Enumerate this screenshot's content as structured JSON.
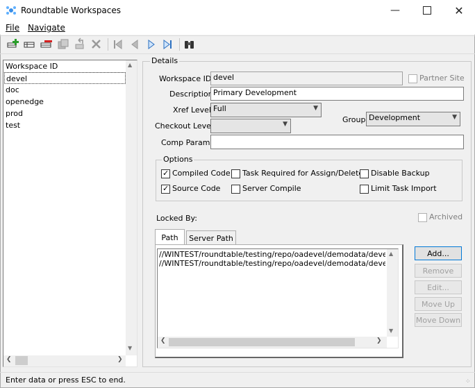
{
  "window": {
    "title": "Roundtable Workspaces"
  },
  "menu": {
    "file": "File",
    "navigate": "Navigate"
  },
  "toolbar": {
    "icons": [
      "add-workspace-icon",
      "edit-workspace-icon",
      "delete-workspace-icon",
      "copy-icon",
      "undo-icon",
      "cancel-icon",
      "first-icon",
      "previous-icon",
      "next-icon",
      "last-icon",
      "find-icon"
    ]
  },
  "list": {
    "header": "Workspace ID",
    "items": [
      "devel",
      "doc",
      "openedge",
      "prod",
      "test"
    ],
    "selected": "devel"
  },
  "details": {
    "group_title": "Details",
    "workspace_id_label": "Workspace ID:",
    "workspace_id_value": "devel",
    "partner_site_label": "Partner Site",
    "description_label": "Description:",
    "description_value": "Primary Development",
    "xref_level_label": "Xref Level:",
    "xref_level_value": "Full",
    "group_label": "Group:",
    "group_value": "Development",
    "checkout_level_label": "Checkout Level:",
    "checkout_level_value": "",
    "comp_params_label": "Comp Params:",
    "comp_params_value": ""
  },
  "options": {
    "title": "Options",
    "compiled_code": "Compiled Code",
    "task_required": "Task Required for Assign/Delete",
    "disable_backup": "Disable Backup",
    "source_code": "Source Code",
    "server_compile": "Server Compile",
    "limit_task_import": "Limit Task Import"
  },
  "locked_by_label": "Locked By:",
  "archived_label": "Archived",
  "tabs": {
    "path": "Path",
    "server_path": "Server Path"
  },
  "paths": [
    "//WINTEST/roundtable/testing/repo/oadevel/demodata/devel",
    "//WINTEST/roundtable/testing/repo/oadevel/demodata/devel/prod"
  ],
  "buttons": {
    "add": "Add...",
    "remove": "Remove",
    "edit": "Edit...",
    "move_up": "Move Up",
    "move_down": "Move Down"
  },
  "status": "Enter data or press ESC to end."
}
